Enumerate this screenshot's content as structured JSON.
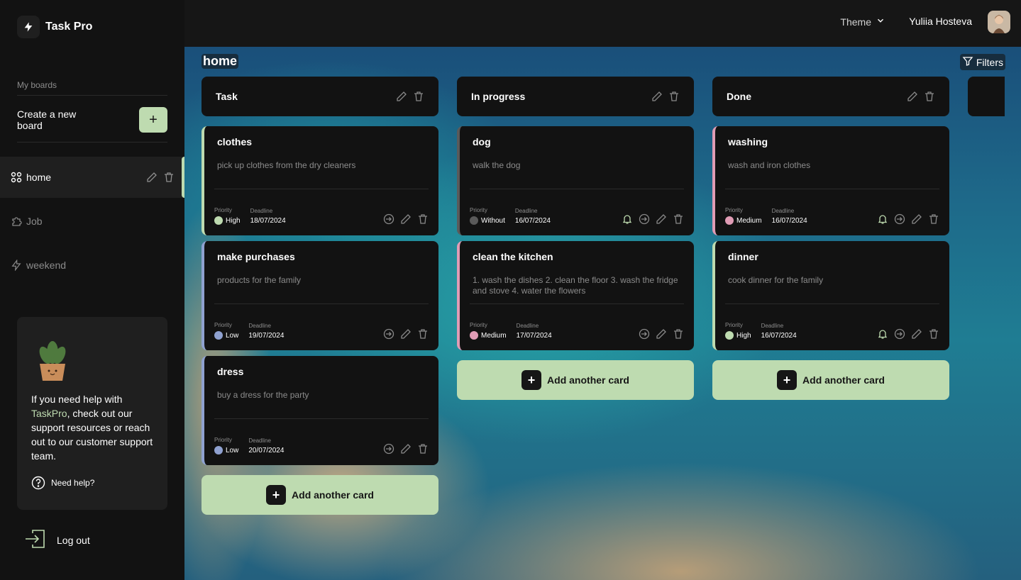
{
  "app": {
    "name": "Task Pro"
  },
  "sidebar": {
    "my_boards_label": "My boards",
    "create_label": "Create a new board",
    "boards": [
      {
        "name": "home",
        "icon": "four-circles-icon",
        "active": true
      },
      {
        "name": "Job",
        "icon": "puzzle-icon",
        "active": false
      },
      {
        "name": "weekend",
        "icon": "lightning-icon",
        "active": false
      }
    ],
    "help": {
      "text_before": "If you need help with ",
      "accent": "TaskPro",
      "text_after": ", check out our support resources or reach out to our customer support team.",
      "need_help": "Need help?"
    },
    "logout": "Log out"
  },
  "header": {
    "theme": "Theme",
    "user": "Yuliia Hosteva"
  },
  "board": {
    "title": "home",
    "filters": "Filters",
    "add_card_label": "Add another card",
    "priority_label": "Priority",
    "deadline_label": "Deadline",
    "columns": [
      {
        "title": "Task",
        "cards": [
          {
            "title": "clothes",
            "description": "pick up clothes from the dry cleaners",
            "priority": "High",
            "deadline": "18/07/2024",
            "bell": false
          },
          {
            "title": "make purchases",
            "description": "products for the family",
            "priority": "Low",
            "deadline": "19/07/2024",
            "bell": false
          },
          {
            "title": "dress",
            "description": "buy a dress for the party",
            "priority": "Low",
            "deadline": "20/07/2024",
            "bell": false
          }
        ]
      },
      {
        "title": "In progress",
        "cards": [
          {
            "title": "dog",
            "description": "walk the dog",
            "priority": "Without",
            "deadline": "16/07/2024",
            "bell": true
          },
          {
            "title": "clean the kitchen",
            "description": "1. wash the dishes 2. clean the floor 3. wash the fridge and stove 4. water the flowers",
            "priority": "Medium",
            "deadline": "17/07/2024",
            "bell": false
          }
        ]
      },
      {
        "title": "Done",
        "cards": [
          {
            "title": "washing",
            "description": "wash and iron clothes",
            "priority": "Medium",
            "deadline": "16/07/2024",
            "bell": true
          },
          {
            "title": "dinner",
            "description": "cook dinner for the family",
            "priority": "High",
            "deadline": "16/07/2024",
            "bell": true
          }
        ]
      }
    ]
  },
  "colors": {
    "accent": "#bedbb0",
    "priority": {
      "Low": "#8fa1d0",
      "Medium": "#e09cb5",
      "High": "#bedbb0",
      "Without": "#5a5a5a"
    }
  }
}
